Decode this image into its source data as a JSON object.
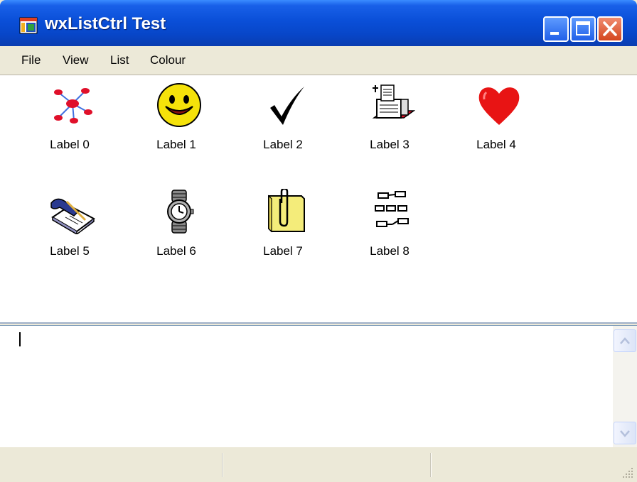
{
  "window": {
    "title": "wxListCtrl Test"
  },
  "title_buttons": {
    "minimize": "minimize-icon",
    "maximize": "maximize-icon",
    "close": "close-icon"
  },
  "menu": [
    "File",
    "View",
    "List",
    "Colour"
  ],
  "list_items": [
    {
      "label": "Label 0",
      "icon": "network-icon"
    },
    {
      "label": "Label 1",
      "icon": "smiley-icon"
    },
    {
      "label": "Label 2",
      "icon": "checkmark-icon"
    },
    {
      "label": "Label 3",
      "icon": "printer-icon"
    },
    {
      "label": "Label 4",
      "icon": "heart-icon"
    },
    {
      "label": "Label 5",
      "icon": "notepad-pen-icon"
    },
    {
      "label": "Label 6",
      "icon": "wristwatch-icon"
    },
    {
      "label": "Label 7",
      "icon": "paperclip-note-icon"
    },
    {
      "label": "Label 8",
      "icon": "flowchart-icon"
    }
  ],
  "log_text": "",
  "status_fields": [
    "",
    "",
    ""
  ],
  "colors": {
    "title_blue": "#0A4FD8",
    "menu_bg": "#ECE9D8",
    "close_red": "#D4461F",
    "heart_red": "#E81414",
    "smiley_yellow": "#F5E20A"
  }
}
